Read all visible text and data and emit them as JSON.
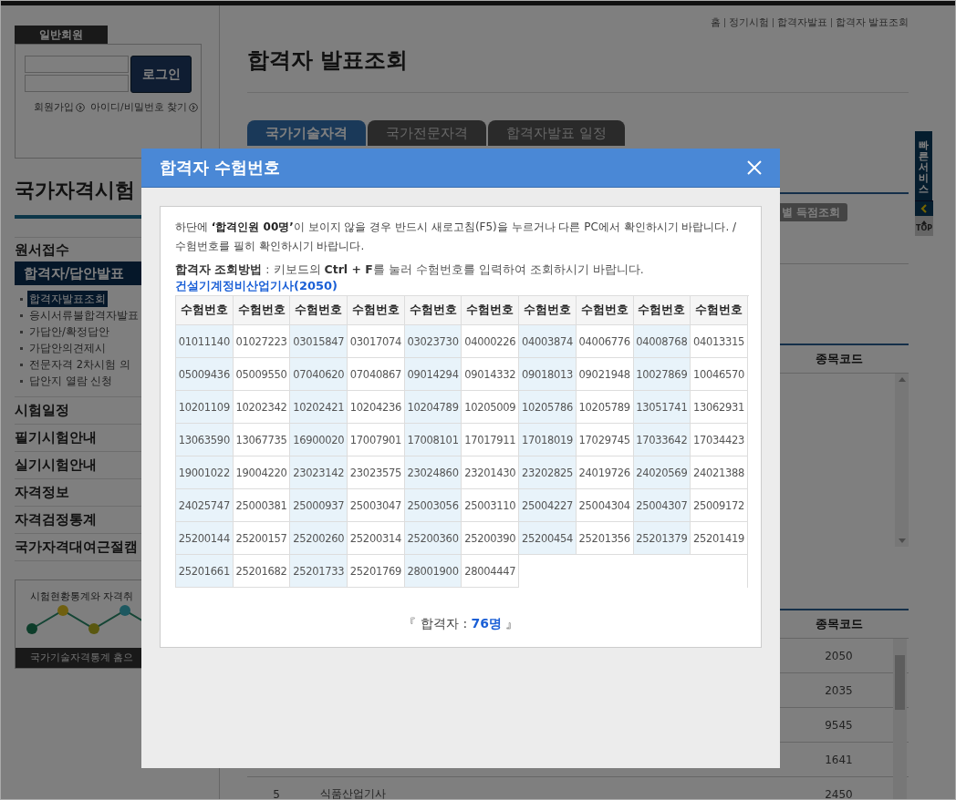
{
  "breadcrumb": [
    "홈",
    "정기시험",
    "합격자발표",
    "합격자 발표조회"
  ],
  "login": {
    "label": "일반회원",
    "button": "로그인",
    "links": [
      "회원가입",
      "아이디/비밀번호 찾기"
    ]
  },
  "sidebar": {
    "title": "국가자격시험",
    "items": [
      {
        "label": "원서접수",
        "selected": false
      },
      {
        "label": "합격자/답안발표",
        "selected": true,
        "children": [
          {
            "label": "합격자발표조회",
            "selected": true
          },
          {
            "label": "응시서류불합격자발표",
            "selected": false
          },
          {
            "label": "가답안/확정답안",
            "selected": false
          },
          {
            "label": "가답안의견제시",
            "selected": false
          },
          {
            "label": "전문자격 2차시험 의",
            "selected": false
          },
          {
            "label": "답안지 열람 신청",
            "selected": false
          }
        ]
      },
      {
        "label": "시험일정",
        "selected": false
      },
      {
        "label": "필기시험안내",
        "selected": false
      },
      {
        "label": "실기시험안내",
        "selected": false
      },
      {
        "label": "자격정보",
        "selected": false
      },
      {
        "label": "자격검정통계",
        "selected": false
      },
      {
        "label": "국가자격대여근절캠",
        "selected": false
      }
    ]
  },
  "banner": {
    "caption": "시험현황통계와 자격취",
    "button": "국가기술자격통계 홈으"
  },
  "page_title": "합격자 발표조회",
  "tabs": [
    {
      "label": "국가기술자격",
      "selected": true
    },
    {
      "label": "국가전문자격",
      "selected": false
    },
    {
      "label": "합격자발표 일정",
      "selected": false
    }
  ],
  "score_button": "별 득점조회",
  "code_tables": [
    {
      "header": "종목코드"
    },
    {
      "header": "종목코드",
      "rows": [
        {
          "code": "2050"
        },
        {
          "code": "2035"
        },
        {
          "code": "9545"
        },
        {
          "code": "1641"
        },
        {
          "no": "5",
          "name": "식품산업기사",
          "code": "2450"
        }
      ]
    }
  ],
  "quick_service": {
    "label": "빠른서비스",
    "top": "TOP"
  },
  "modal": {
    "title": "합격자 수험번호",
    "notice": "하단에 **‘합격인원 00명’**이 보이지 않을 경우 반드시 새로고침(F5)을 누르거나 다른 PC에서 확인하시기 바랍니다. / 수험번호를 필히 확인하시기 바랍니다.",
    "method": "**합격자 조회방법** : 키보드의 **Ctrl + F**를 눌러 수험번호를 입력하여 조회하시기 바랍니다.",
    "exam_name": "건설기계정비산업기사(2050)",
    "columns": [
      "수험번호",
      "수험번호",
      "수험번호",
      "수험번호",
      "수험번호",
      "수험번호",
      "수험번호",
      "수험번호",
      "수험번호",
      "수험번호"
    ],
    "numbers": [
      "01011140",
      "01027223",
      "03015847",
      "03017074",
      "03023730",
      "04000226",
      "04003874",
      "04006776",
      "04008768",
      "04013315",
      "05009436",
      "05009550",
      "07040620",
      "07040867",
      "09014294",
      "09014332",
      "09018013",
      "09021948",
      "10027869",
      "10046570",
      "10201109",
      "10202342",
      "10202421",
      "10204236",
      "10204789",
      "10205009",
      "10205786",
      "10205789",
      "13051741",
      "13062931",
      "13063590",
      "13067735",
      "16900020",
      "17007901",
      "17008101",
      "17017911",
      "17018019",
      "17029745",
      "17033642",
      "17034423",
      "19001022",
      "19004220",
      "23023142",
      "23023575",
      "23024860",
      "23201430",
      "23202825",
      "24019726",
      "24020569",
      "24021388",
      "24025747",
      "25000381",
      "25000937",
      "25003047",
      "25003056",
      "25003110",
      "25004227",
      "25004304",
      "25004307",
      "25009172",
      "25200144",
      "25200157",
      "25200260",
      "25200314",
      "25200360",
      "25200390",
      "25200454",
      "25201356",
      "25201379",
      "25201419",
      "25201661",
      "25201682",
      "25201733",
      "25201769",
      "28001900",
      "28004447"
    ],
    "total": "『 합격자 : **76명** 』"
  }
}
